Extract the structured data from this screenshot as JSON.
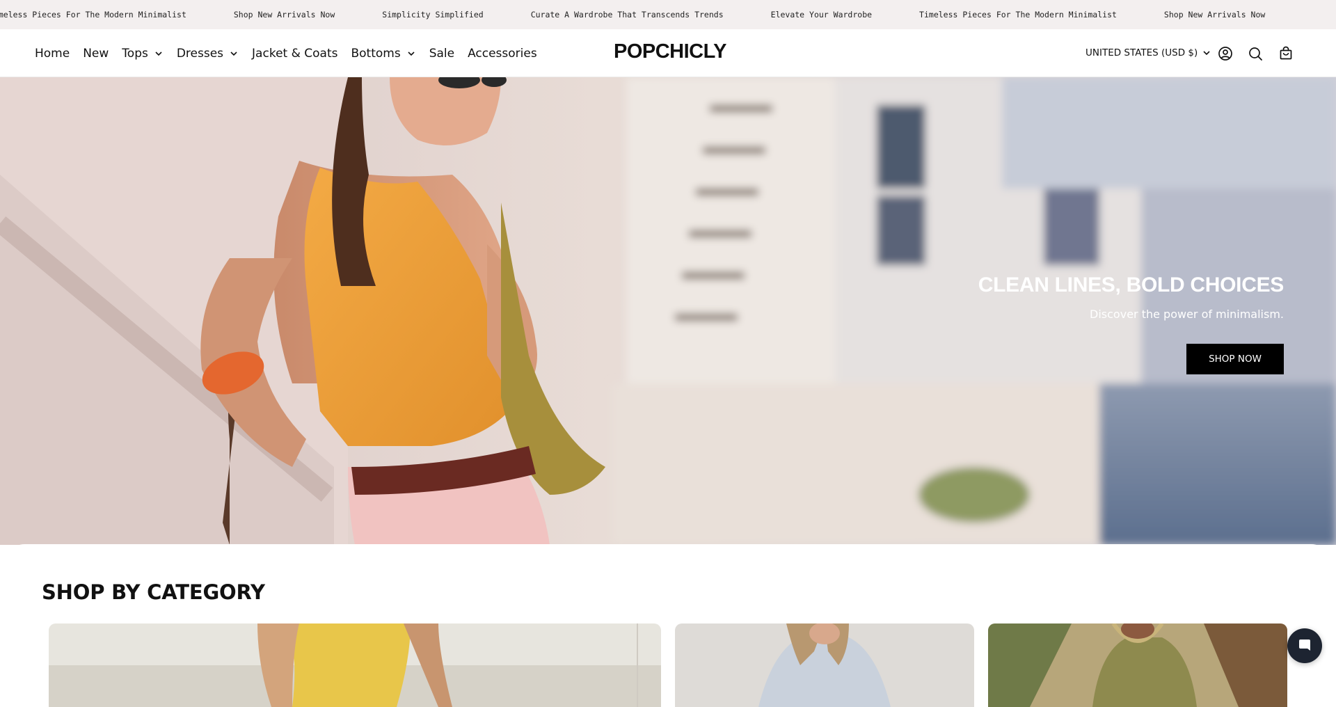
{
  "announcement": {
    "items": [
      "Timeless Pieces For The Modern Minimalist",
      "Shop New Arrivals Now",
      "Simplicity Simplified",
      "Curate A Wardrobe That Transcends Trends",
      "Elevate Your Wardrobe",
      "Timeless Pieces For The Modern Minimalist",
      "Shop New Arrivals Now"
    ]
  },
  "nav": {
    "items": [
      {
        "label": "Home",
        "has_dropdown": false
      },
      {
        "label": "New",
        "has_dropdown": false
      },
      {
        "label": "Tops",
        "has_dropdown": true
      },
      {
        "label": "Dresses",
        "has_dropdown": true
      },
      {
        "label": "Jacket & Coats",
        "has_dropdown": false
      },
      {
        "label": "Bottoms",
        "has_dropdown": true
      },
      {
        "label": "Sale",
        "has_dropdown": false
      },
      {
        "label": "Accessories",
        "has_dropdown": false
      }
    ]
  },
  "header": {
    "logo": "POPCHICLY",
    "currency": "UNITED STATES (USD $)",
    "icons": [
      "account-icon",
      "search-icon",
      "cart-icon"
    ]
  },
  "hero": {
    "title": "CLEAN LINES, BOLD CHOICES",
    "subtitle": "Discover the power of minimalism.",
    "button": "SHOP NOW"
  },
  "category": {
    "title": "SHOP BY CATEGORY"
  },
  "chat": {
    "icon": "chat-icon"
  },
  "colors": {
    "announcement_bg": "#f3efef",
    "button_bg": "#000000",
    "chat_bg": "#1d2431"
  }
}
